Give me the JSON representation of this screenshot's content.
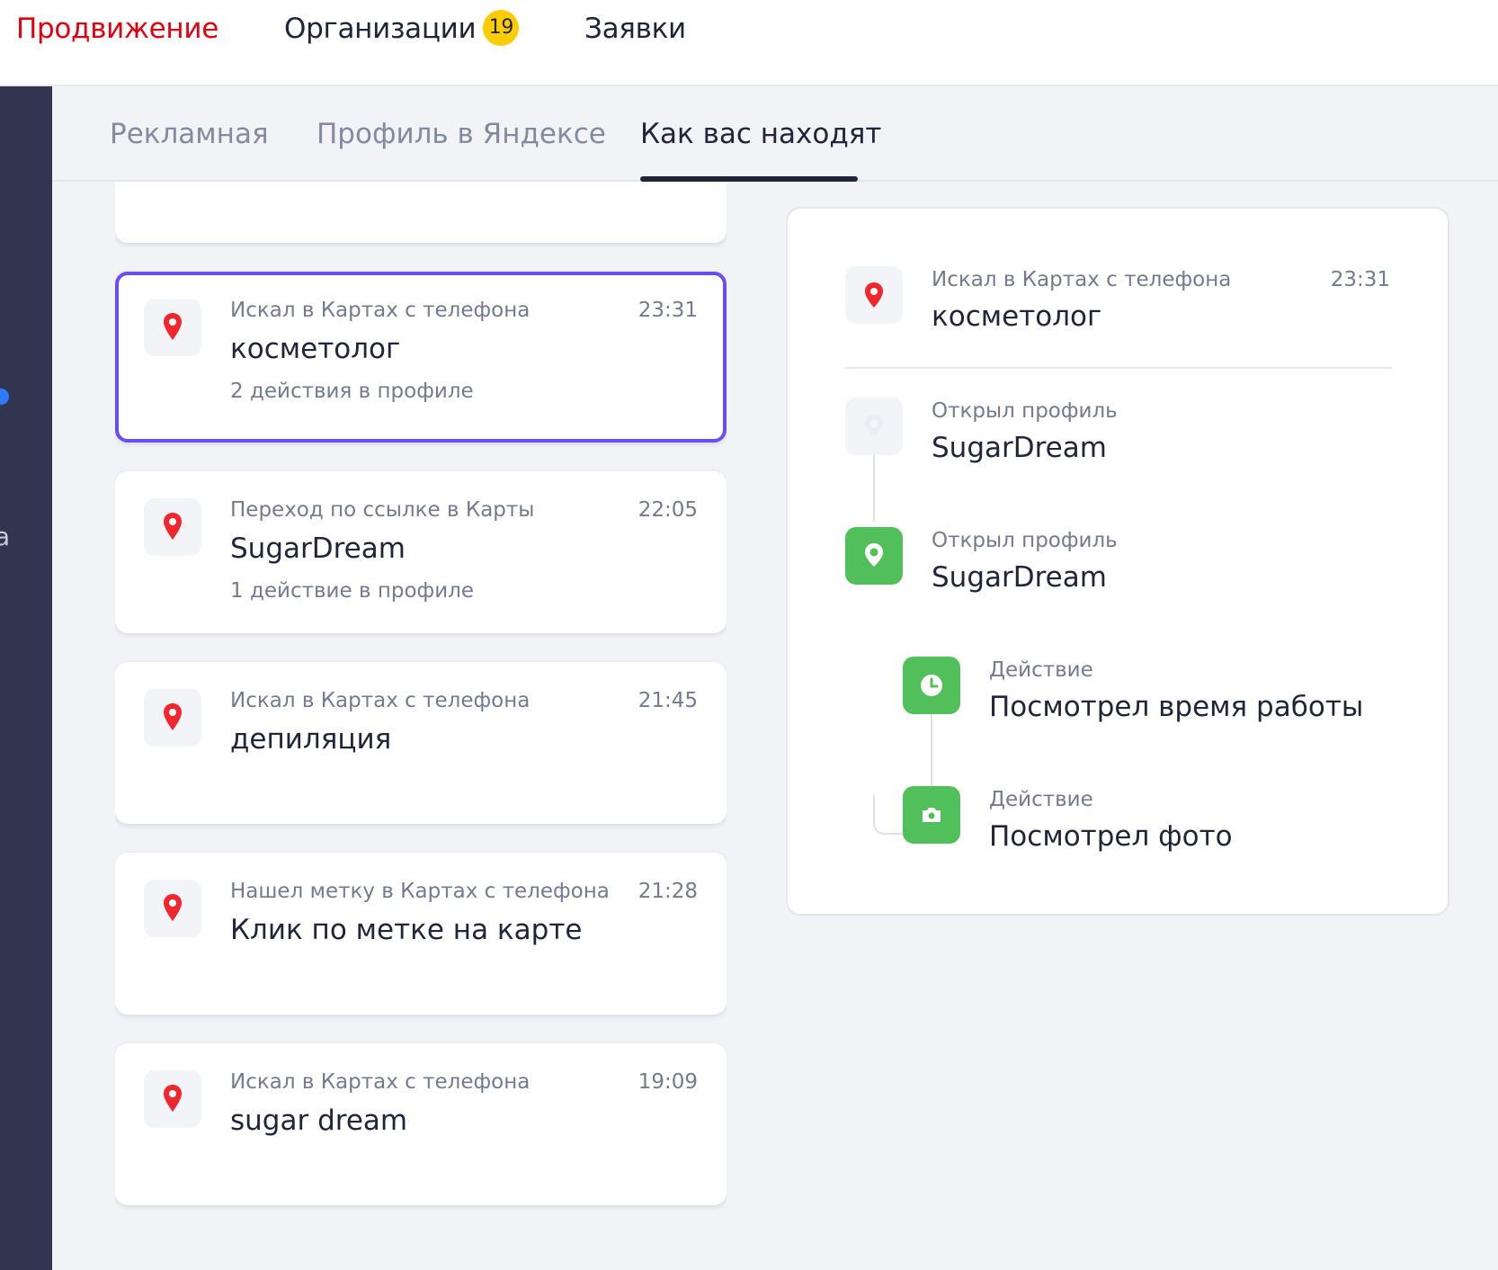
{
  "topnav": {
    "items": [
      {
        "label": "Продвижение",
        "active": true
      },
      {
        "label": "Организации",
        "badge": "19"
      },
      {
        "label": "Заявки"
      }
    ]
  },
  "rail": {
    "letter": "а"
  },
  "subtabs": [
    {
      "label": "Рекламная"
    },
    {
      "label": "Профиль в Яндексе"
    },
    {
      "label": "Как вас находят",
      "active": true
    }
  ],
  "sessions": [
    {
      "source": "Искал в Картах с телефона",
      "time": "23:31",
      "query": "косметолог",
      "actions": "2 действия в профиле",
      "selected": true
    },
    {
      "source": "Переход по ссылке в Карты",
      "time": "22:05",
      "query": "SugarDream",
      "actions": "1 действие в профиле"
    },
    {
      "source": "Искал в Картах с телефона",
      "time": "21:45",
      "query": "депиляция",
      "actions": ""
    },
    {
      "source": "Нашел метку в Картах с телефона",
      "time": "21:28",
      "query": "Клик по метке на карте",
      "actions": ""
    },
    {
      "source": "Искал в Картах с телефона",
      "time": "19:09",
      "query": "sugar dream",
      "actions": ""
    }
  ],
  "detail": {
    "header": {
      "source": "Искал в Картах с телефона",
      "time": "23:31",
      "query": "косметолог"
    },
    "steps": [
      {
        "type": "Открыл профиль",
        "name": "SugarDream",
        "icon": "map-pin-icon-faded"
      },
      {
        "type": "Открыл профиль",
        "name": "SugarDream",
        "icon": "map-pin-icon"
      },
      {
        "type": "Действие",
        "name": "Посмотрел время работы",
        "icon": "clock-icon"
      },
      {
        "type": "Действие",
        "name": "Посмотрел фото",
        "icon": "camera-icon"
      }
    ]
  },
  "colors": {
    "brand_red": "#e3000f",
    "selected_border": "#6a4df5",
    "action_green": "#52c05a",
    "badge_yellow": "#ffcc00",
    "rail": "#323550"
  }
}
